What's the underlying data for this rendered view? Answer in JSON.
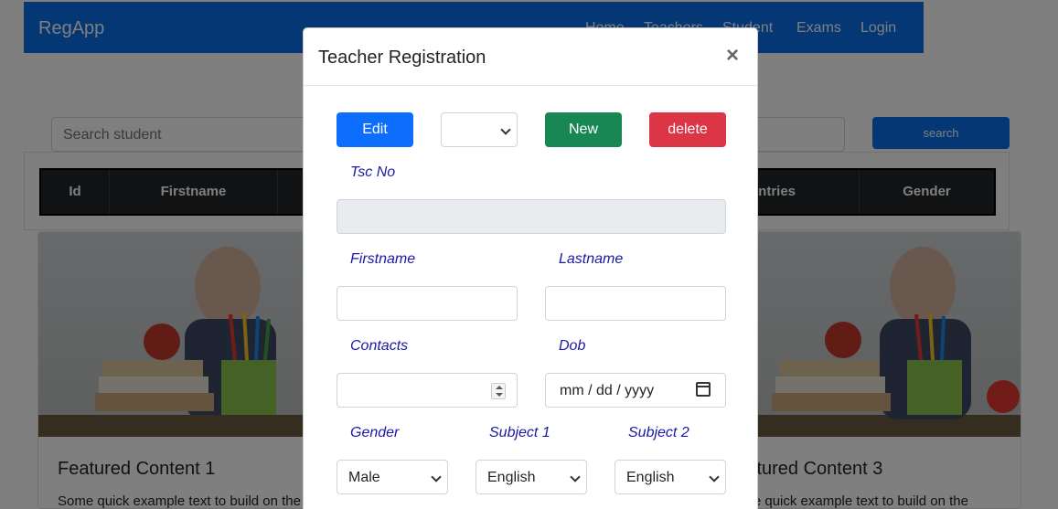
{
  "app": {
    "brand": "RegApp",
    "nav": [
      "Home",
      "Teachers",
      "Student",
      "Exams",
      "Login"
    ]
  },
  "page": {
    "search_placeholder": "Search student",
    "search_button": "search",
    "table_headers": [
      "Id",
      "Firstname",
      "Countries",
      "Gender"
    ],
    "cards": [
      {
        "title": "Featured Content 1",
        "text": "Some quick example text to build on the"
      },
      {
        "title": "Featured Content 3",
        "text": "Some quick example text to build on the"
      }
    ]
  },
  "modal": {
    "title": "Teacher Registration",
    "close": "×",
    "edit_button": "Edit",
    "new_button": "New",
    "delete_button": "delete",
    "labels": {
      "tsc_no": "Tsc No",
      "firstname": "Firstname",
      "lastname": "Lastname",
      "contacts": "Contacts",
      "dob": "Dob",
      "gender": "Gender",
      "subject1": "Subject 1",
      "subject2": "Subject 2"
    },
    "dob_placeholder": "mm / dd / yyyy",
    "gender_value": "Male",
    "subject1_value": "English",
    "subject2_value": "English"
  },
  "colors": {
    "primary": "#0a6ee8",
    "edit": "#0d6efd",
    "new": "#198754",
    "delete": "#dc3545",
    "label": "#1a1aa6"
  }
}
